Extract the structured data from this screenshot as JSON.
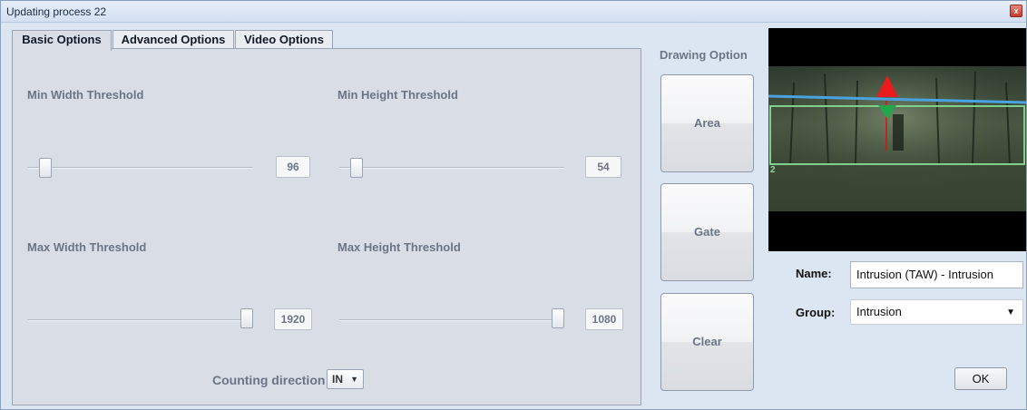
{
  "window": {
    "title": "Updating process 22",
    "close_glyph": "x"
  },
  "tabs": [
    {
      "label": "Basic Options",
      "active": true
    },
    {
      "label": "Advanced Options",
      "active": false
    },
    {
      "label": "Video Options",
      "active": false
    }
  ],
  "basic": {
    "min_width": {
      "label": "Min Width Threshold",
      "value": "96",
      "level": 0.05
    },
    "min_height": {
      "label": "Min Height Threshold",
      "value": "54",
      "level": 0.05
    },
    "max_width": {
      "label": "Max Width Threshold",
      "value": "1920",
      "level": 1.0
    },
    "max_height": {
      "label": "Max Height Threshold",
      "value": "1080",
      "level": 1.0
    },
    "counting_direction": {
      "label": "Counting direction",
      "value": "IN"
    }
  },
  "drawing": {
    "title": "Drawing Option",
    "buttons": [
      "Area",
      "Gate",
      "Clear"
    ]
  },
  "preview": {
    "zone_label": "2",
    "gate_color": "#4aa3e0",
    "area_color": "#7fd08a",
    "arrow_up_color": "#e81c1c",
    "arrow_down_color": "#22a84a"
  },
  "form": {
    "name_label": "Name:",
    "name_value": "Intrusion (TAW)  -  Intrusion",
    "group_label": "Group:",
    "group_value": "Intrusion",
    "ok_label": "OK"
  },
  "icons": {
    "dropdown": "chevron-down-icon",
    "close": "close-icon"
  }
}
